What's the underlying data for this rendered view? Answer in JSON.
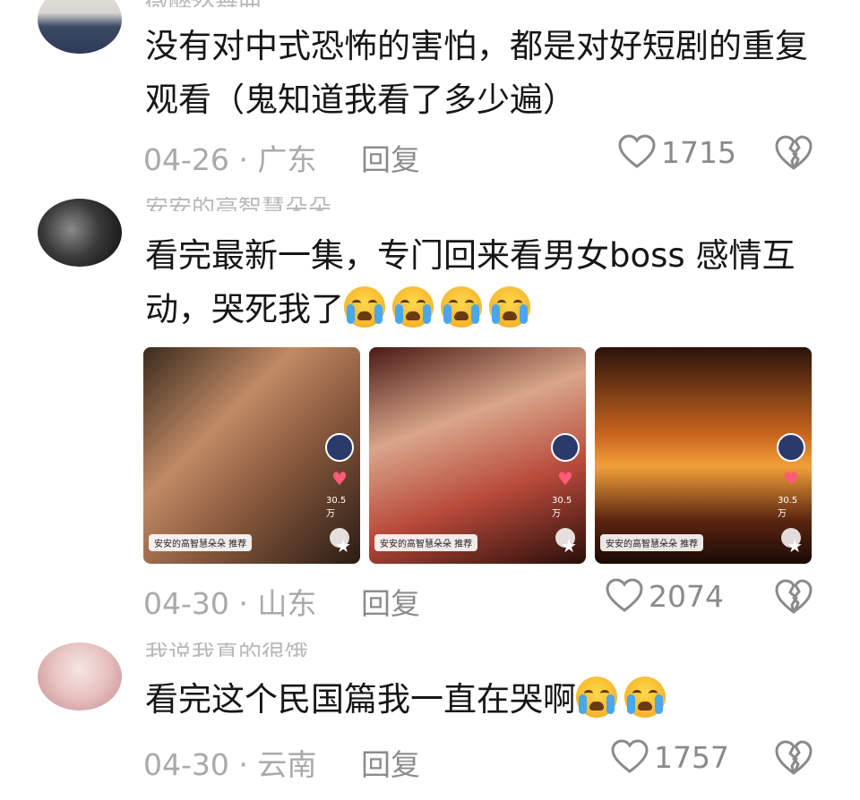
{
  "comments": [
    {
      "username": "微醉然舞曲",
      "text": "没有对中式恐怖的害怕，都是对好短剧的重复观看（鬼知道我看了多少遍）",
      "date_location": "04-26 · 广东",
      "reply_label": "回复",
      "likes": "1715"
    },
    {
      "username": "安安的高智慧朵朵",
      "text": "看完最新一集，专门回来看男女boss 感情互动，哭死我了",
      "emoji_count": 4,
      "thumbnails": [
        {
          "tag": "安安的高智慧朵朵 推荐",
          "likes": "30.5万"
        },
        {
          "tag": "安安的高智慧朵朵 推荐",
          "likes": "30.5万"
        },
        {
          "tag": "安安的高智慧朵朵 推荐",
          "likes": "30.5万"
        }
      ],
      "date_location": "04-30 · 山东",
      "reply_label": "回复",
      "likes": "2074"
    },
    {
      "username": "我说我真的很饿",
      "text": "看完这个民国篇我一直在哭啊",
      "emoji_count": 2,
      "date_location": "04-30 · 云南",
      "reply_label": "回复",
      "likes": "1757"
    }
  ],
  "icons": {
    "like": "heart-outline-icon",
    "dislike": "broken-heart-icon",
    "emoji": "loudly-crying-face-emoji"
  },
  "colors": {
    "meta_text": "#a9a9a9",
    "body_text": "#161616",
    "like_icon": "#8a8a8a"
  }
}
